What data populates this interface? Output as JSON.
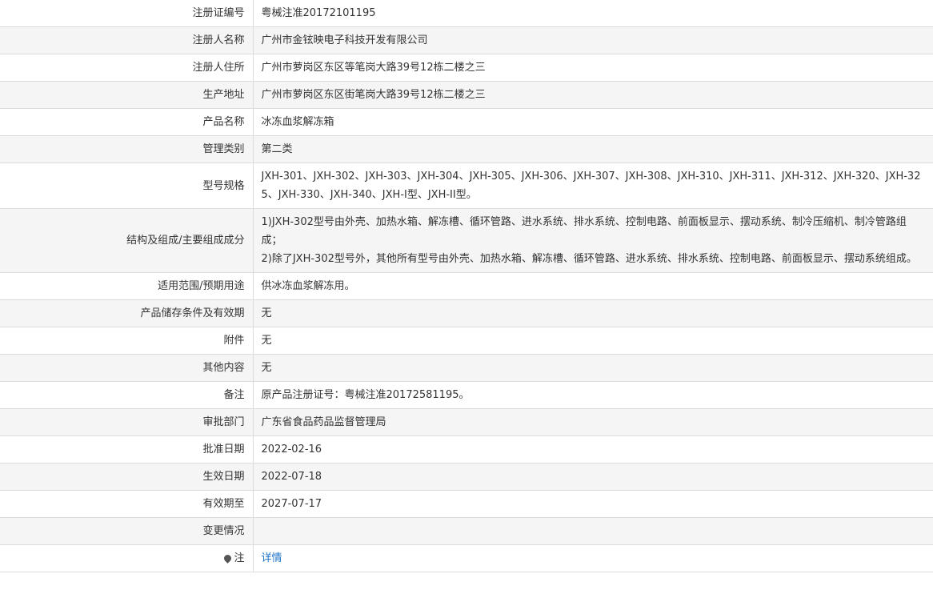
{
  "rows": [
    {
      "label": "注册证编号",
      "value": "粤械注准20172101195"
    },
    {
      "label": "注册人名称",
      "value": "广州市金铉映电子科技开发有限公司"
    },
    {
      "label": "注册人住所",
      "value": "广州市萝岗区东区等笔岗大路39号12栋二楼之三"
    },
    {
      "label": "生产地址",
      "value": "广州市萝岗区东区街笔岗大路39号12栋二楼之三"
    },
    {
      "label": "产品名称",
      "value": "冰冻血浆解冻箱"
    },
    {
      "label": "管理类别",
      "value": "第二类"
    },
    {
      "label": "型号规格",
      "value": "JXH-301、JXH-302、JXH-303、JXH-304、JXH-305、JXH-306、JXH-307、JXH-308、JXH-310、JXH-311、JXH-312、JXH-320、JXH-325、JXH-330、JXH-340、JXH-I型、JXH-II型。"
    },
    {
      "label": "结构及组成/主要组成成分",
      "lines": [
        "1)JXH-302型号由外壳、加热水箱、解冻槽、循环管路、进水系统、排水系统、控制电路、前面板显示、摆动系统、制冷压缩机、制冷管路组成；",
        "2)除了JXH-302型号外，其他所有型号由外壳、加热水箱、解冻槽、循环管路、进水系统、排水系统、控制电路、前面板显示、摆动系统组成。"
      ]
    },
    {
      "label": "适用范围/预期用途",
      "value": "供冰冻血浆解冻用。"
    },
    {
      "label": "产品储存条件及有效期",
      "value": "无"
    },
    {
      "label": "附件",
      "value": "无"
    },
    {
      "label": "其他内容",
      "value": "无"
    },
    {
      "label": "备注",
      "value": "原产品注册证号：粤械注准20172581195。"
    },
    {
      "label": "审批部门",
      "value": "广东省食品药品监督管理局"
    },
    {
      "label": "批准日期",
      "value": "2022-02-16"
    },
    {
      "label": "生效日期",
      "value": "2022-07-18"
    },
    {
      "label": "有效期至",
      "value": "2027-07-17"
    },
    {
      "label": "变更情况",
      "value": ""
    },
    {
      "label": "注",
      "value": "详情",
      "icon": "pin-icon"
    }
  ]
}
